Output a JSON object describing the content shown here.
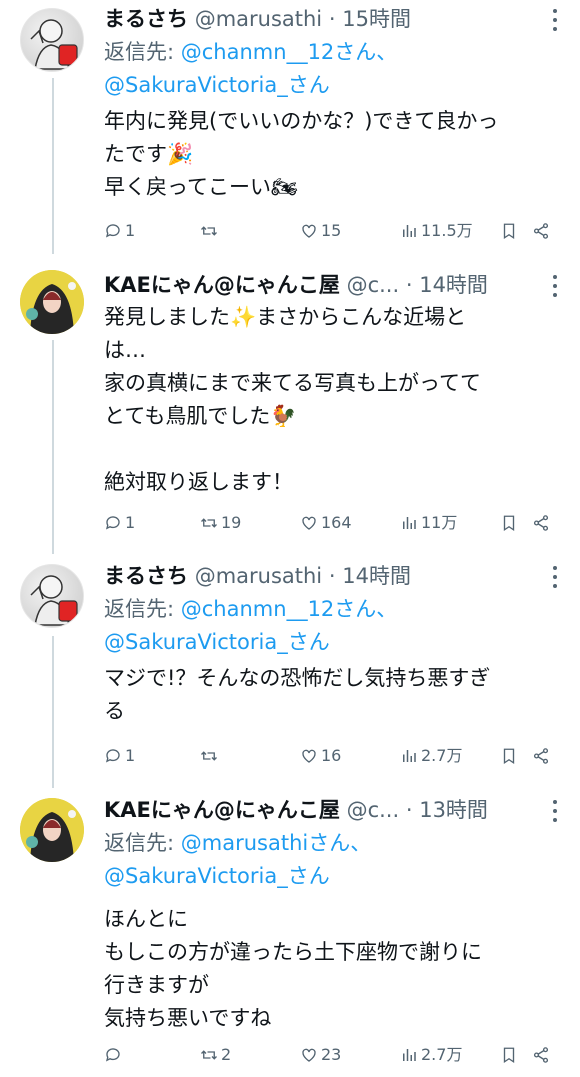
{
  "colors": {
    "accent": "#1d9bf0",
    "muted": "#536471",
    "text": "#0f1419",
    "divider": "#cfd9de"
  },
  "tweets": [
    {
      "name": "まるさち",
      "handle": "@marusathi",
      "dot": "·",
      "time": "15時間",
      "reply_prefix": "返信先: ",
      "mention1": "@chanmn__12さん、",
      "mention2": "@SakuraVictoria_さん",
      "text": "年内に発見(でいいのかな？)できて良かっ\nたです🎉\n早く戻ってこーい🏍",
      "replies": "1",
      "retweets": "",
      "likes": "15",
      "views": "11.5万",
      "avatar": "marusathi-avatar"
    },
    {
      "name": "KAEにゃん@にゃんこ屋",
      "handle": "@c...",
      "dot": "·",
      "time": "14時間",
      "text": "発見しました✨まさからこんな近場と\nは…\n家の真横にまで来てる写真も上がってて\nとても鳥肌でした🐓\n\n絶対取り返します！",
      "replies": "1",
      "retweets": "19",
      "likes": "164",
      "views": "11万",
      "avatar": "kae-avatar"
    },
    {
      "name": "まるさち",
      "handle": "@marusathi",
      "dot": "·",
      "time": "14時間",
      "reply_prefix": "返信先: ",
      "mention1": "@chanmn__12さん、",
      "mention2": "@SakuraVictoria_さん",
      "text": "マジで!？そんなの恐怖だし気持ち悪すぎ\nる",
      "replies": "1",
      "retweets": "",
      "likes": "16",
      "views": "2.7万",
      "avatar": "marusathi-avatar"
    },
    {
      "name": "KAEにゃん@にゃんこ屋",
      "handle": "@c...",
      "dot": "·",
      "time": "13時間",
      "reply_prefix": "返信先: ",
      "mention1": "@marusathiさん、",
      "mention2": "@SakuraVictoria_さん",
      "text": "ほんとに\nもしこの方が違ったら土下座物で謝りに\n行きますが\n気持ち悪いですね",
      "replies": "",
      "retweets": "2",
      "likes": "23",
      "views": "2.7万",
      "avatar": "kae-avatar"
    }
  ]
}
